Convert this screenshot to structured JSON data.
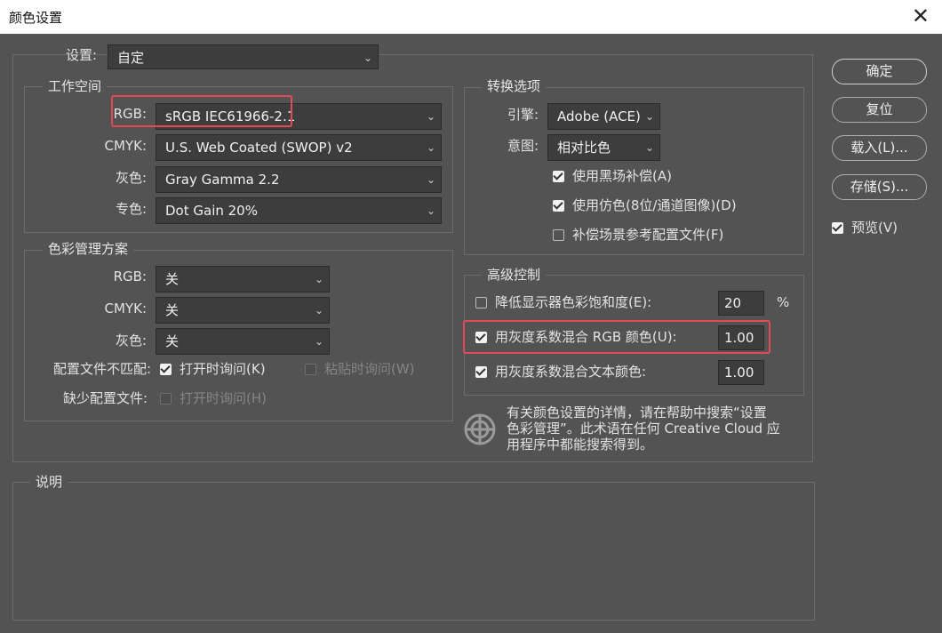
{
  "window": {
    "title": "颜色设置",
    "close_glyph": "✕"
  },
  "settings": {
    "label": "设置:",
    "value": "自定"
  },
  "working_spaces": {
    "title": "工作空间",
    "rows": [
      {
        "label": "RGB:",
        "value": "sRGB IEC61966-2.1"
      },
      {
        "label": "CMYK:",
        "value": "U.S. Web Coated (SWOP) v2"
      },
      {
        "label": "灰色:",
        "value": "Gray Gamma 2.2"
      },
      {
        "label": "专色:",
        "value": "Dot Gain 20%"
      }
    ]
  },
  "color_management": {
    "title": "色彩管理方案",
    "rows": [
      {
        "label": "RGB:",
        "value": "关"
      },
      {
        "label": "CMYK:",
        "value": "关"
      },
      {
        "label": "灰色:",
        "value": "关"
      }
    ],
    "mismatch_label": "配置文件不匹配:",
    "ask_open": "打开时询问(K)",
    "ask_paste": "粘贴时询问(W)",
    "missing_label": "缺少配置文件:",
    "missing_ask_open": "打开时询问(H)"
  },
  "conversion": {
    "title": "转换选项",
    "engine_label": "引擎:",
    "engine_value": "Adobe (ACE)",
    "intent_label": "意图:",
    "intent_value": "相对比色",
    "bpc": "使用黑场补偿(A)",
    "dither": "使用仿色(8位/通道图像)(D)",
    "compensate": "补偿场景参考配置文件(F)"
  },
  "advanced": {
    "title": "高级控制",
    "desaturate_label": "降低显示器色彩饱和度(E):",
    "desaturate_value": "20",
    "desaturate_unit": "%",
    "blend_rgb_label": "用灰度系数混合 RGB 颜色(U):",
    "blend_rgb_value": "1.00",
    "blend_text_label": "用灰度系数混合文本颜色:",
    "blend_text_value": "1.00"
  },
  "info": {
    "line1": "有关颜色设置的详情，请在帮助中搜索“设置",
    "line2": "色彩管理”。此术语在任何 Creative Cloud 应",
    "line3": "用程序中都能搜索得到。"
  },
  "description": {
    "title": "说明"
  },
  "buttons": {
    "ok": "确定",
    "reset": "复位",
    "load": "载入(L)...",
    "save": "存储(S)..."
  },
  "preview": {
    "label": "预览(V)"
  },
  "icons": {
    "dropdown": "chevron-down-icon",
    "info": "color-wheel-icon",
    "close": "close-icon"
  }
}
